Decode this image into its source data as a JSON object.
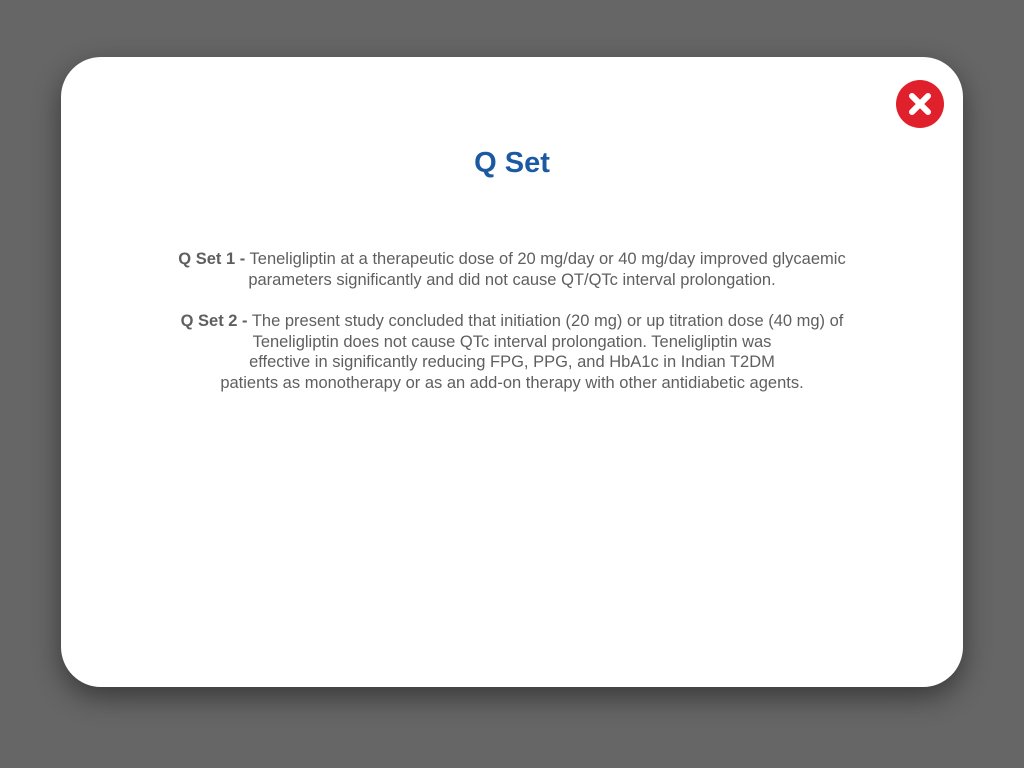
{
  "modal": {
    "title": "Q Set",
    "close_icon": "close-icon",
    "close_color": "#e0202a",
    "title_color": "#1b5aa3",
    "paragraphs": [
      {
        "label": "Q Set 1 -",
        "lines": [
          "Teneligliptin at a therapeutic dose of 20 mg/day or 40 mg/day improved glycaemic",
          "parameters significantly and did not cause QT/QTc interval prolongation."
        ]
      },
      {
        "label": "Q Set 2 -",
        "lines": [
          "The present study concluded that initiation (20 mg) or up titration dose (40 mg) of",
          "Teneligliptin does not cause QTc interval prolongation. Teneligliptin was",
          "effective in significantly reducing FPG, PPG, and HbA1c in Indian T2DM",
          "patients as monotherapy or as an add-on therapy with other antidiabetic agents."
        ]
      }
    ]
  }
}
